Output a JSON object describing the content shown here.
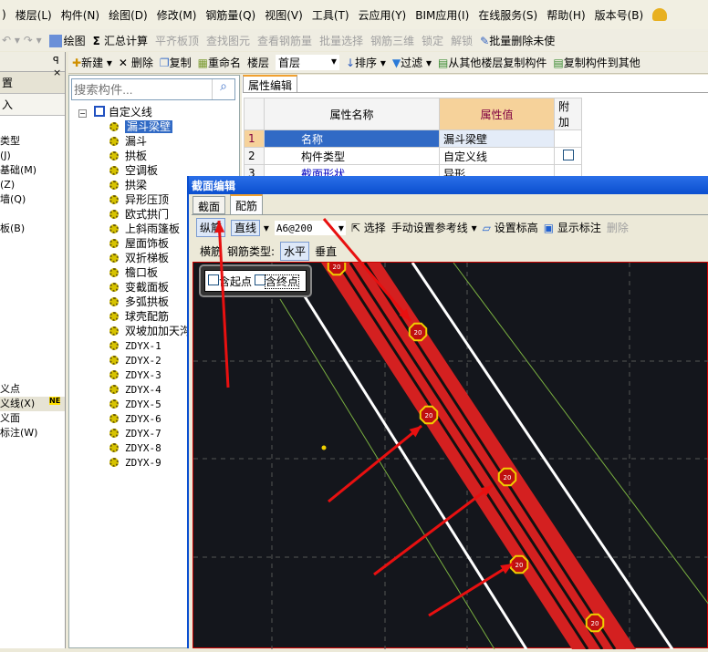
{
  "menu": [
    "楼层(L)",
    "构件(N)",
    "绘图(D)",
    "修改(M)",
    "钢筋量(Q)",
    "视图(V)",
    "工具(T)",
    "云应用(Y)",
    "BIM应用(I)",
    "在线服务(S)",
    "帮助(H)",
    "版本号(B)"
  ],
  "toolbar1": {
    "draw": "绘图",
    "sum": "汇总计算",
    "align": "平齐板顶",
    "find": "查找图元",
    "view_rebar": "查看钢筋量",
    "batch": "批量选择",
    "rebar3d": "钢筋三维",
    "lock": "锁定",
    "unlock": "解锁",
    "batch_delete": "批量删除未使"
  },
  "toolbar2": {
    "new": "新建",
    "delete": "删除",
    "copy": "复制",
    "rename": "重命名",
    "floor_label": "楼层",
    "floor_value": "首层",
    "sort": "排序",
    "filter": "过滤",
    "copy_from": "从其他楼层复制构件",
    "copy_to": "复制构件到其他"
  },
  "left_panel": {
    "header": "置",
    "section": "入",
    "items": [
      "类型",
      "(J)",
      "基础(M)",
      "(Z)",
      "墙(Q)",
      "",
      "板(B)",
      "",
      "",
      "",
      "",
      "",
      "",
      "",
      "",
      "",
      "",
      "义点",
      "义线(X)",
      "义面",
      "标注(W)"
    ],
    "badge": "NE"
  },
  "search": {
    "placeholder": "搜索构件..."
  },
  "tree": {
    "root": "自定义线",
    "items": [
      "漏斗梁壁",
      "漏斗",
      "拱板",
      "空调板",
      "拱梁",
      "异形压顶",
      "欧式拱门",
      "上斜雨篷板",
      "屋面饰板",
      "双折梯板",
      "檐口板",
      "变截面板",
      "多弧拱板",
      "球壳配筋",
      "双坡加加天沟",
      "ZDYX-1",
      "ZDYX-2",
      "ZDYX-3",
      "ZDYX-4",
      "ZDYX-5",
      "ZDYX-6",
      "ZDYX-7",
      "ZDYX-8",
      "ZDYX-9"
    ],
    "selected": "漏斗梁壁"
  },
  "property": {
    "tab": "属性编辑",
    "headers": [
      "属性名称",
      "属性值",
      "附加"
    ],
    "rows": [
      {
        "n": "1",
        "name": "名称",
        "value": "漏斗梁壁",
        "check": false
      },
      {
        "n": "2",
        "name": "构件类型",
        "value": "自定义线",
        "check": true
      },
      {
        "n": "3",
        "name": "截面形状",
        "value": "异形",
        "check": false
      }
    ]
  },
  "dialog": {
    "title": "截面编辑",
    "tabs": [
      "截面",
      "配筋"
    ],
    "active_tab": "配筋",
    "toolbar": {
      "long_rebar": "纵筋",
      "line": "直线",
      "spec": "A6@200",
      "select": "选择",
      "manual_ref": "手动设置参考线",
      "set_elev": "设置标高",
      "show_label": "显示标注",
      "delete": "删除"
    },
    "row2": {
      "trans_rebar": "横筋",
      "type_label": "钢筋类型:",
      "horizontal": "水平",
      "vertical": "垂直"
    },
    "checkboxes": {
      "start": "含起点",
      "end": "含终点"
    },
    "marker_label": "20"
  },
  "colors": {
    "rebar_band": "#d42020",
    "canvas": "#14161c",
    "annotation_arrow": "#e81010",
    "marker": "#f0d000"
  }
}
